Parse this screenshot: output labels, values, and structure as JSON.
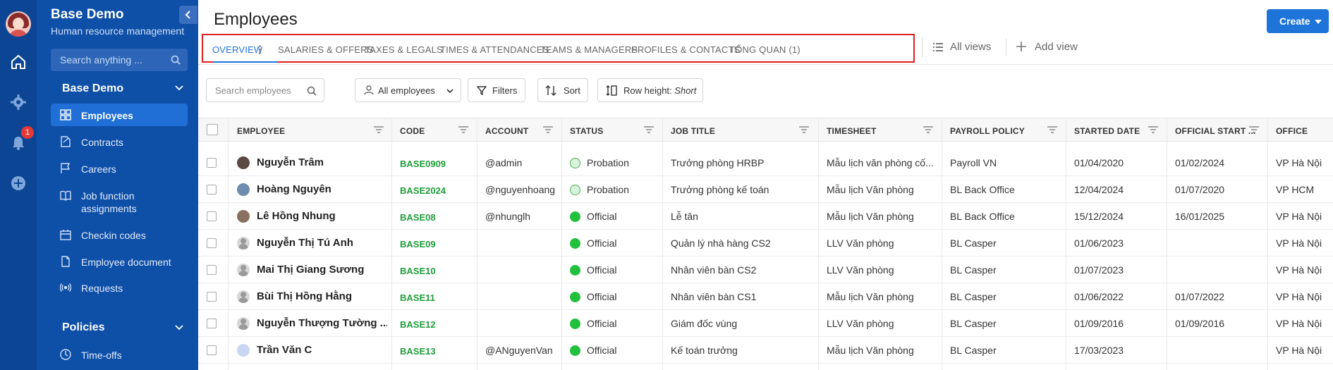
{
  "sidebar": {
    "brand_title": "Base Demo",
    "brand_subtitle": "Human resource management",
    "search_placeholder": "Search anything ...",
    "notification_count": "1",
    "section_title": "Base Demo",
    "items": [
      {
        "label": "Employees",
        "icon": "grid-icon",
        "active": true
      },
      {
        "label": "Contracts",
        "icon": "contract-icon"
      },
      {
        "label": "Careers",
        "icon": "flag-icon"
      },
      {
        "label": "Job function assignments",
        "icon": "book-icon"
      },
      {
        "label": "Checkin codes",
        "icon": "calendar-icon"
      },
      {
        "label": "Employee document",
        "icon": "document-icon"
      },
      {
        "label": "Requests",
        "icon": "broadcast-icon"
      }
    ],
    "policies_title": "Policies",
    "policies_items": [
      {
        "label": "Time-offs",
        "icon": "clock-icon"
      }
    ]
  },
  "header": {
    "title": "Employees",
    "create_label": "Create"
  },
  "tabs": [
    {
      "label": "OVERVIEW",
      "active": true
    },
    {
      "label": "SALARIES & OFFERS"
    },
    {
      "label": "TAXES & LEGALS"
    },
    {
      "label": "TIMES & ATTENDANCES"
    },
    {
      "label": "TEAMS & MANAGERS"
    },
    {
      "label": "PROFILES & CONTACTS"
    },
    {
      "label": "TỔNG QUAN (1)"
    }
  ],
  "views": {
    "all_views": "All views",
    "add_view": "Add view"
  },
  "toolbar": {
    "search_placeholder": "Search employees",
    "filter_select": "All employees",
    "filters": "Filters",
    "sort": "Sort",
    "row_height_label": "Row height: ",
    "row_height_value": "Short"
  },
  "table": {
    "columns": [
      "EMPLOYEE",
      "CODE",
      "ACCOUNT",
      "STATUS",
      "JOB TITLE",
      "TIMESHEET",
      "PAYROLL POLICY",
      "STARTED DATE",
      "OFFICIAL START ...",
      "OFFICE"
    ],
    "rows": [
      {
        "name": "Nguyễn Trâm",
        "code": "BASE0909",
        "account": "@admin",
        "status": "Probation",
        "job": "Trưởng phòng HRBP",
        "timesheet": "Mẫu lịch văn phòng cố...",
        "payroll": "Payroll VN",
        "started": "01/04/2020",
        "official": "01/02/2024",
        "office": "VP Hà Nội"
      },
      {
        "name": "Hoàng Nguyên",
        "code": "BASE2024",
        "account": "@nguyenhoang",
        "status": "Probation",
        "job": "Trưởng phòng kế toán",
        "timesheet": "Mẫu lịch Văn phòng",
        "payroll": "BL Back Office",
        "started": "12/04/2024",
        "official": "01/07/2020",
        "office": "VP HCM"
      },
      {
        "name": "Lê Hồng Nhung",
        "code": "BASE08",
        "account": "@nhunglh",
        "status": "Official",
        "job": "Lễ tân",
        "timesheet": "Mẫu lịch Văn phòng",
        "payroll": "BL Back Office",
        "started": "15/12/2024",
        "official": "16/01/2025",
        "office": "VP Hà Nội"
      },
      {
        "name": "Nguyễn Thị Tú Anh",
        "code": "BASE09",
        "account": "",
        "status": "Official",
        "job": "Quản lý nhà hàng CS2",
        "timesheet": "LLV Văn phòng",
        "payroll": "BL Casper",
        "started": "01/06/2023",
        "official": "",
        "office": "VP Hà Nội"
      },
      {
        "name": "Mai Thị Giang Sương",
        "code": "BASE10",
        "account": "",
        "status": "Official",
        "job": "Nhân viên bàn CS2",
        "timesheet": "LLV Văn phòng",
        "payroll": "BL Casper",
        "started": "01/07/2023",
        "official": "",
        "office": "VP Hà Nội"
      },
      {
        "name": "Bùi Thị Hồng Hằng",
        "code": "BASE11",
        "account": "",
        "status": "Official",
        "job": "Nhân viên bàn CS1",
        "timesheet": "Mẫu lịch Văn phòng",
        "payroll": "BL Casper",
        "started": "01/06/2022",
        "official": "01/07/2022",
        "office": "VP Hà Nội"
      },
      {
        "name": "Nguyễn Thượng Tường ...",
        "code": "BASE12",
        "account": "",
        "status": "Official",
        "job": "Giám đốc vùng",
        "timesheet": "LLV Văn phòng",
        "payroll": "BL Casper",
        "started": "01/09/2016",
        "official": "01/09/2016",
        "office": "VP Hà Nội"
      },
      {
        "name": "Trần Văn C",
        "code": "BASE13",
        "account": "@ANguyenVan",
        "status": "Official",
        "job": "Kế toán trưởng",
        "timesheet": "Mẫu lịch Văn phòng",
        "payroll": "BL Casper",
        "started": "17/03/2023",
        "official": "",
        "office": "VP Hà Nội"
      }
    ]
  }
}
